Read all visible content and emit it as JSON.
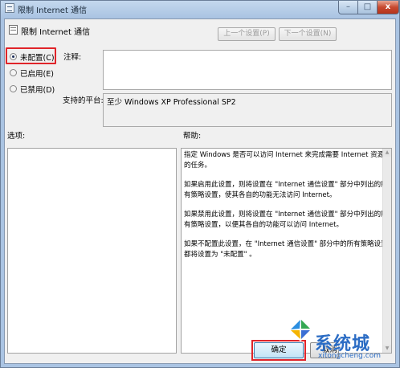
{
  "window": {
    "title": "限制 Internet 通信",
    "min_glyph": "–",
    "max_glyph": "□",
    "close_glyph": "x"
  },
  "policy": {
    "title": "限制 Internet 通信"
  },
  "nav": {
    "prev_label": "上一个设置(P)",
    "next_label": "下一个设置(N)"
  },
  "state": {
    "options": [
      {
        "label": "未配置(C)",
        "selected": true
      },
      {
        "label": "已启用(E)",
        "selected": false
      },
      {
        "label": "已禁用(D)",
        "selected": false
      }
    ]
  },
  "labels": {
    "comment": "注释:",
    "platform": "支持的平台:",
    "options": "选项:",
    "help": "帮助:"
  },
  "platform_value": "至少 Windows XP Professional SP2",
  "help": {
    "paragraphs": [
      "指定 Windows 是否可以访问 Internet 来完成需要 Internet 资源的任务。",
      "如果启用此设置，则将设置在 \"Internet 通信设置\" 部分中列出的所有策略设置，使其各自的功能无法访问 Internet。",
      "如果禁用此设置，则将设置在 \"Internet 通信设置\" 部分中列出的所有策略设置，以便其各自的功能可以访问 Internet。",
      "如果不配置此设置，在 \"Internet 通信设置\" 部分中的所有策略设置都将设置为 \"未配置\" 。"
    ]
  },
  "buttons": {
    "ok_label": "确定",
    "cancel_label": "取消"
  },
  "watermark": {
    "text": "系统城",
    "url": "xitongcheng.com"
  },
  "colors": {
    "highlight_red": "#e0242a",
    "watermark_blue": "#2b6cc4"
  }
}
